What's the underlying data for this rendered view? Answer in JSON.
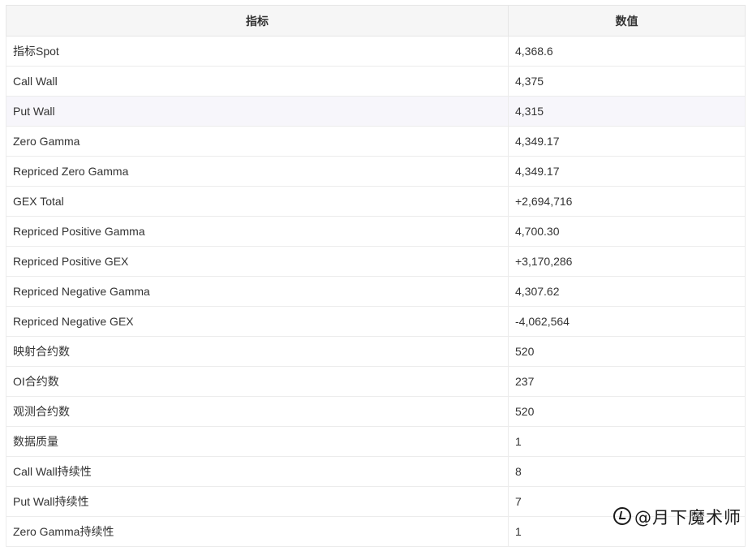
{
  "table": {
    "headers": [
      "指标",
      "数值"
    ],
    "rows": [
      {
        "name": "指标Spot",
        "value": "4,368.6"
      },
      {
        "name": "Call Wall",
        "value": "4,375"
      },
      {
        "name": "Put Wall",
        "value": "4,315"
      },
      {
        "name": "Zero Gamma",
        "value": "4,349.17"
      },
      {
        "name": "Repriced Zero Gamma",
        "value": "4,349.17"
      },
      {
        "name": "GEX Total",
        "value": "+2,694,716"
      },
      {
        "name": "Repriced Positive Gamma",
        "value": "4,700.30"
      },
      {
        "name": "Repriced Positive GEX",
        "value": "+3,170,286"
      },
      {
        "name": "Repriced Negative Gamma",
        "value": "4,307.62"
      },
      {
        "name": "Repriced Negative GEX",
        "value": "-4,062,564"
      },
      {
        "name": "映射合约数",
        "value": "520"
      },
      {
        "name": "OI合约数",
        "value": "237"
      },
      {
        "name": "观测合约数",
        "value": "520"
      },
      {
        "name": "数据质量",
        "value": "1"
      },
      {
        "name": "Call Wall持续性",
        "value": "8"
      },
      {
        "name": "Put Wall持续性",
        "value": "7"
      },
      {
        "name": "Zero Gamma持续性",
        "value": "1"
      }
    ]
  },
  "watermark": {
    "icon": "zhihu-icon",
    "text": "@月下魔术师"
  }
}
